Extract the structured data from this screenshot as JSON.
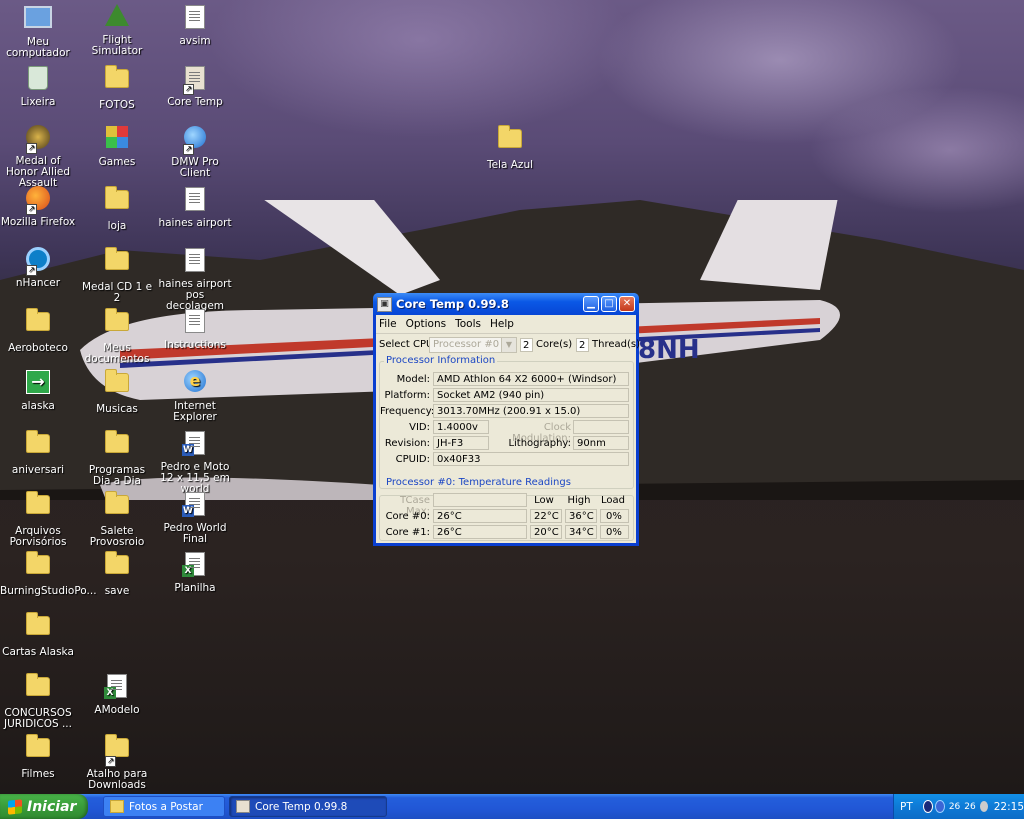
{
  "desktop": {
    "icons": [
      {
        "label": "Meu computador"
      },
      {
        "label": "Lixeira"
      },
      {
        "label": "Medal of Honor Allied Assault"
      },
      {
        "label": "Mozilla Firefox"
      },
      {
        "label": "nHancer"
      },
      {
        "label": "Aeroboteco"
      },
      {
        "label": "alaska"
      },
      {
        "label": "aniversari"
      },
      {
        "label": "Arquivos Porvisórios"
      },
      {
        "label": "BurningStudioPo..."
      },
      {
        "label": "Cartas Alaska"
      },
      {
        "label": "CONCURSOS JURIDICOS ..."
      },
      {
        "label": "Filmes"
      },
      {
        "label": "Flight Simulator"
      },
      {
        "label": "FOTOS"
      },
      {
        "label": "Games"
      },
      {
        "label": "loja"
      },
      {
        "label": "Medal CD 1 e 2"
      },
      {
        "label": "Meus documentos"
      },
      {
        "label": "Musicas"
      },
      {
        "label": "Programas Dia a Dia"
      },
      {
        "label": "Salete Provosroio"
      },
      {
        "label": "save"
      },
      {
        "label": "AModelo"
      },
      {
        "label": "Atalho para Downloads"
      },
      {
        "label": "avsim"
      },
      {
        "label": "Core Temp"
      },
      {
        "label": "DMW Pro Client"
      },
      {
        "label": "haines airport"
      },
      {
        "label": "haines airport pos decolagem"
      },
      {
        "label": "Instructions"
      },
      {
        "label": "Internet Explorer"
      },
      {
        "label": "Pedro e Moto 12 x 11,5 em world"
      },
      {
        "label": "Pedro World Final"
      },
      {
        "label": "Planilha"
      },
      {
        "label": "Tela Azul"
      }
    ],
    "plane_reg": "8NH"
  },
  "window": {
    "title": "Core Temp 0.99.8",
    "icon": "core-temp-app-icon",
    "menu": [
      "File",
      "Options",
      "Tools",
      "Help"
    ],
    "select_cpu_label": "Select CPU:",
    "select_cpu_value": "Processor #0",
    "cores_count": "2",
    "cores_label": "Core(s)",
    "threads_count": "2",
    "threads_label": "Thread(s)",
    "processor_info": {
      "title": "Processor Information",
      "model_label": "Model:",
      "model": "AMD Athlon 64 X2 6000+ (Windsor)",
      "platform_label": "Platform:",
      "platform": "Socket AM2 (940 pin)",
      "frequency_label": "Frequency:",
      "frequency": "3013.70MHz (200.91 x 15.0)",
      "vid_label": "VID:",
      "vid": "1.4000v",
      "clock_modulation_label": "Clock Modulation:",
      "clock_modulation": "",
      "revision_label": "Revision:",
      "revision": "JH-F3",
      "lithography_label": "Lithography:",
      "lithography": "90nm",
      "cpuid_label": "CPUID:",
      "cpuid": "0x40F33"
    },
    "temps": {
      "title": "Processor #0: Temperature Readings",
      "tcase_label": "TCase Max:",
      "tcase": "",
      "col_low": "Low",
      "col_high": "High",
      "col_load": "Load",
      "rows": [
        {
          "label": "Core #0:",
          "temp": "26°C",
          "low": "22°C",
          "high": "36°C",
          "load": "0%"
        },
        {
          "label": "Core #1:",
          "temp": "26°C",
          "low": "20°C",
          "high": "34°C",
          "load": "0%"
        }
      ]
    }
  },
  "taskbar": {
    "start_label": "Iniciar",
    "buttons": [
      {
        "label": "Fotos a Postar"
      },
      {
        "label": "Core Temp 0.99.8"
      }
    ],
    "tray": {
      "lang": "PT",
      "temp1": "26",
      "temp2": "26",
      "clock": "22:15"
    }
  },
  "colors": {
    "xp_title_blue": "#0a58e6",
    "dialog_face": "#ece9d8",
    "group_title": "#1c47c4",
    "start_green": "#3a9c3a"
  }
}
